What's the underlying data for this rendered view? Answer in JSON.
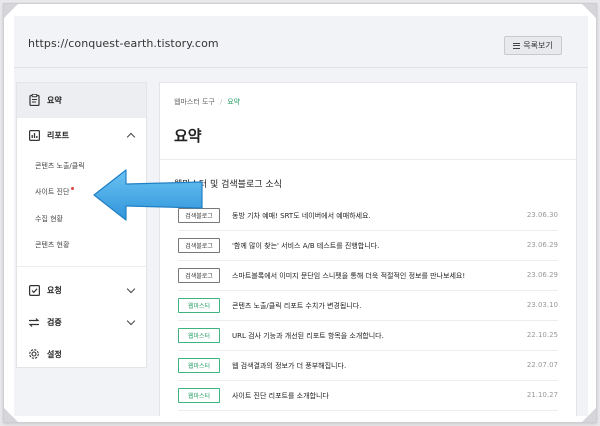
{
  "address_bar": {
    "url": "https://conquest-earth.tistory.com",
    "list_button_label": "목록보기"
  },
  "sidebar": {
    "items": [
      {
        "label": "요약",
        "icon": "clipboard-icon",
        "active": true
      },
      {
        "label": "리포트",
        "icon": "chart-icon",
        "expanded": true
      },
      {
        "label": "요청",
        "icon": "check-square-icon"
      },
      {
        "label": "검증",
        "icon": "swap-icon"
      },
      {
        "label": "설정",
        "icon": "gear-icon"
      }
    ],
    "report_subitems": [
      {
        "label": "콘텐츠 노출/클릭"
      },
      {
        "label": "사이트 진단",
        "badge": "new-dot"
      },
      {
        "label": "수집 현황"
      },
      {
        "label": "콘텐츠 현황"
      }
    ]
  },
  "main": {
    "breadcrumb": {
      "root": "웹마스터 도구",
      "separator": "/",
      "current": "요약"
    },
    "title": "요약",
    "section_title": "웹마스터 및 검색블로그 소식",
    "news": [
      {
        "tag": "검색블로그",
        "tag_style": "gray",
        "text": "동방 기차 예매! SRT도 네이버에서 예매하세요.",
        "date": "23.06.30"
      },
      {
        "tag": "검색블로그",
        "tag_style": "gray",
        "text": "'함께 많이 찾는' 서비스 A/B 테스트를 진행합니다.",
        "date": "23.06.29"
      },
      {
        "tag": "검색블로그",
        "tag_style": "gray",
        "text": "스마트블록에서 이미지 문단임 스니펫을 통해 더욱 적절적인 정보를 만나보세요!",
        "date": "23.06.29"
      },
      {
        "tag": "웹마스터",
        "tag_style": "green",
        "text": "콘텐츠 노출/클릭 리포트 수치가 변경됩니다.",
        "date": "23.03.10"
      },
      {
        "tag": "웹마스터",
        "tag_style": "green",
        "text": "URL 검사 기능과 개선된 리포트 항목을 소개합니다.",
        "date": "22.10.25"
      },
      {
        "tag": "웹마스터",
        "tag_style": "green",
        "text": "웹 검색결과의 정보가 더 풍부해집니다.",
        "date": "22.07.07"
      },
      {
        "tag": "웹마스터",
        "tag_style": "green",
        "text": "사이트 진단 리포트를 소개합니다",
        "date": "21.10.27"
      }
    ]
  },
  "colors": {
    "accent_green": "#2aa06a",
    "arrow_blue": "#3aa3e3",
    "badge_red": "#e0433a"
  }
}
